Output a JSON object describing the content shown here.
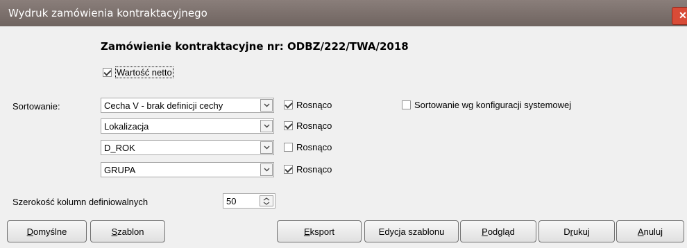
{
  "window": {
    "title": "Wydruk zamówienia kontraktacyjnego",
    "close_label": "✕"
  },
  "order_title": "Zamówienie kontraktacyjne nr: ODBZ/222/TWA/2018",
  "net_value": {
    "label": "Wartość netto",
    "checked": true
  },
  "sorting": {
    "label": "Sortowanie:",
    "rows": [
      {
        "value": "Cecha V - brak definicji cechy",
        "asc_label": "Rosnąco",
        "asc_checked": true
      },
      {
        "value": "Lokalizacja",
        "asc_label": "Rosnąco",
        "asc_checked": true
      },
      {
        "value": "D_ROK",
        "asc_label": "Rosnąco",
        "asc_checked": false
      },
      {
        "value": "GRUPA",
        "asc_label": "Rosnąco",
        "asc_checked": true
      }
    ],
    "system_config": {
      "label": "Sortowanie wg konfiguracji systemowej",
      "checked": false
    }
  },
  "column_width": {
    "label": "Szerokość kolumn definiowalnych",
    "value": "50"
  },
  "buttons": {
    "default": {
      "accel": "D",
      "rest": "omyślne"
    },
    "template": {
      "accel": "S",
      "rest": "zablon"
    },
    "export": {
      "accel": "E",
      "rest": "ksport"
    },
    "edit_template": {
      "label": "Edycja szablonu"
    },
    "preview": {
      "accel": "P",
      "rest": "odgląd"
    },
    "print": {
      "pre": "D",
      "accel": "r",
      "rest": "ukuj"
    },
    "cancel": {
      "accel": "A",
      "rest": "nuluj"
    }
  }
}
